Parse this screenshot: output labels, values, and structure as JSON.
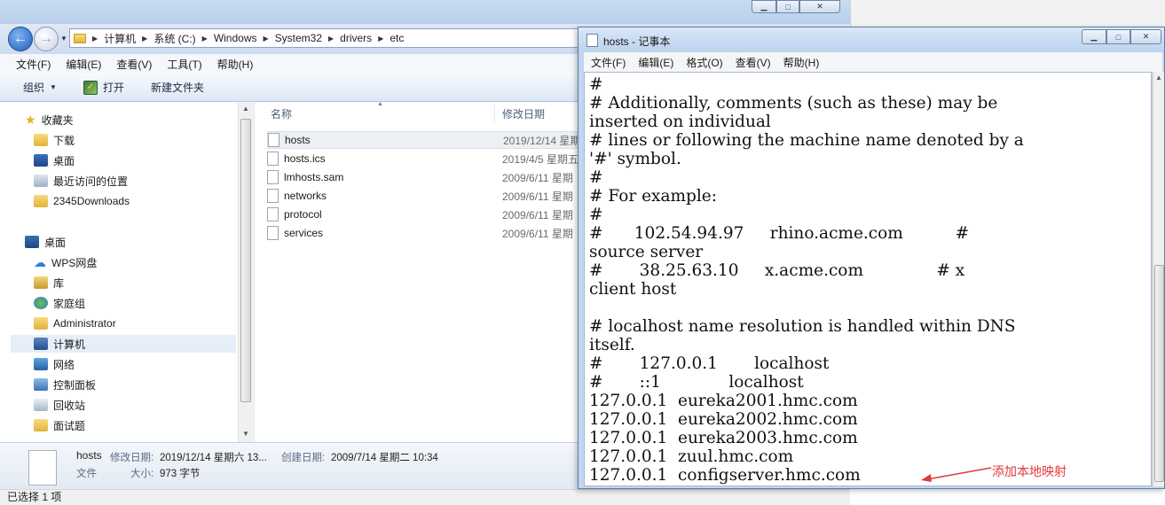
{
  "explorer": {
    "address": {
      "crumbs": [
        "计算机",
        "系统 (C:)",
        "Windows",
        "System32",
        "drivers",
        "etc"
      ]
    },
    "menu": [
      "文件(F)",
      "编辑(E)",
      "查看(V)",
      "工具(T)",
      "帮助(H)"
    ],
    "toolbar": {
      "organize": "组织",
      "open": "打开",
      "new_folder": "新建文件夹"
    },
    "nav": {
      "favorites_header": "收藏夹",
      "favorites": [
        "下载",
        "桌面",
        "最近访问的位置",
        "2345Downloads"
      ],
      "desktop_header": "桌面",
      "tree": [
        "WPS网盘",
        "库",
        "家庭组",
        "Administrator",
        "计算机",
        "网络",
        "控制面板",
        "回收站",
        "面试题"
      ]
    },
    "columns": {
      "name": "名称",
      "date": "修改日期"
    },
    "files": [
      {
        "name": "hosts",
        "date": "2019/12/14 星期"
      },
      {
        "name": "hosts.ics",
        "date": "2019/4/5 星期五"
      },
      {
        "name": "lmhosts.sam",
        "date": "2009/6/11 星期"
      },
      {
        "name": "networks",
        "date": "2009/6/11 星期"
      },
      {
        "name": "protocol",
        "date": "2009/6/11 星期"
      },
      {
        "name": "services",
        "date": "2009/6/11 星期"
      }
    ],
    "details": {
      "name": "hosts",
      "modified_label": "修改日期:",
      "modified": "2019/12/14 星期六 13...",
      "created_label": "创建日期:",
      "created": "2009/7/14 星期二 10:34",
      "type": "文件",
      "size_label": "大小:",
      "size": "973 字节"
    },
    "status": "已选择 1 项"
  },
  "notepad": {
    "title": "hosts - 记事本",
    "menu": [
      "文件(F)",
      "编辑(E)",
      "格式(O)",
      "查看(V)",
      "帮助(H)"
    ],
    "lines": [
      "#",
      "# Additionally, comments (such as these) may be",
      "inserted on individual",
      "# lines or following the machine name denoted by a",
      "'#' symbol.",
      "#",
      "# For example:",
      "#",
      "#      102.54.94.97     rhino.acme.com          #",
      "source server",
      "#       38.25.63.10     x.acme.com              # x",
      "client host",
      "",
      "# localhost name resolution is handled within DNS",
      "itself.",
      "#       127.0.0.1       localhost",
      "#       ::1             localhost",
      "127.0.0.1  eureka2001.hmc.com",
      "127.0.0.1  eureka2002.hmc.com",
      "127.0.0.1  eureka2003.hmc.com",
      "127.0.0.1  zuul.hmc.com",
      "127.0.0.1  configserver.hmc.com"
    ]
  },
  "annotation": {
    "text": "添加本地映射",
    "color": "#e23a3a"
  }
}
